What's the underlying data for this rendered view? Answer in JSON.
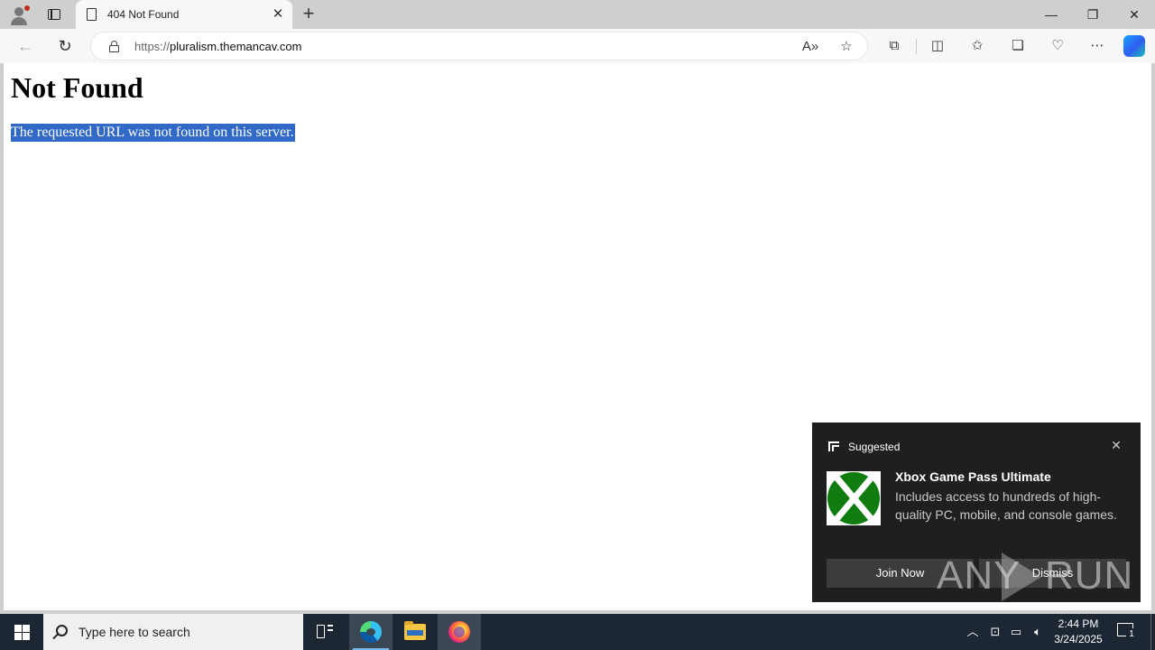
{
  "browser": {
    "tab": {
      "title": "404 Not Found"
    },
    "address": {
      "protocol": "https://",
      "host": "pluralism.themancav.com"
    }
  },
  "page": {
    "heading": "Not Found",
    "message": "The requested URL was not found on this server."
  },
  "toast": {
    "header": "Suggested",
    "title": "Xbox Game Pass Ultimate",
    "body": "Includes access to hundreds of high-quality PC, mobile, and console games.",
    "join_label": "Join Now",
    "dismiss_label": "Dismiss",
    "brand_color": "#107c10"
  },
  "watermark": {
    "left": "ANY",
    "right": "RUN"
  },
  "taskbar": {
    "search_placeholder": "Type here to search",
    "time": "2:44 PM",
    "date": "3/24/2025",
    "notification_count": "1"
  }
}
